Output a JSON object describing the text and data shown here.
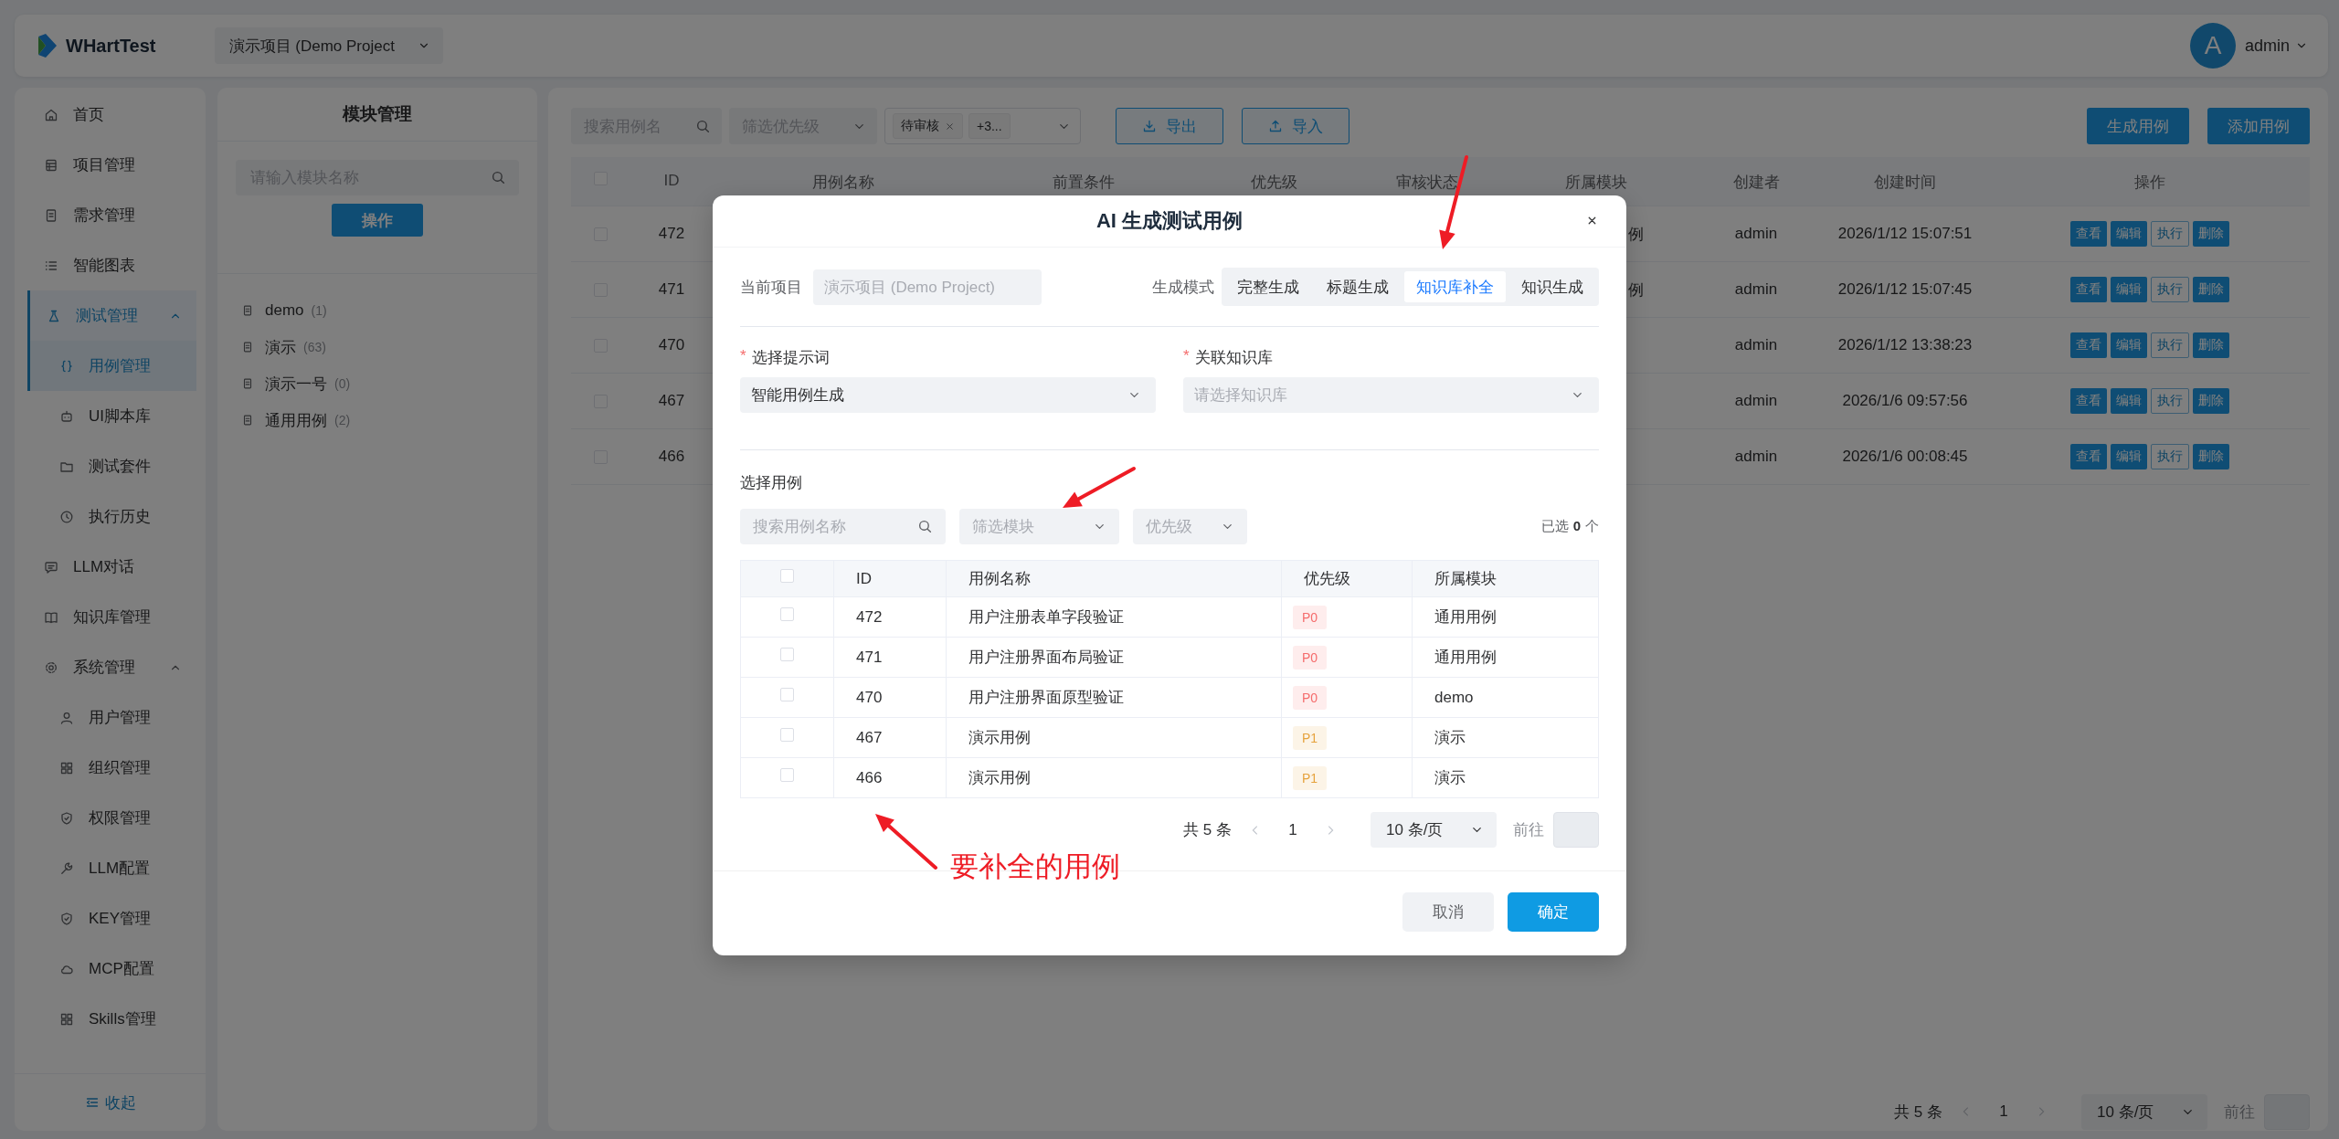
{
  "header": {
    "app_name": "WHartTest",
    "project": "演示项目 (Demo Project",
    "user": {
      "avatar": "A",
      "name": "admin"
    }
  },
  "sidebar": {
    "items": [
      {
        "label": "首页",
        "selected": false
      },
      {
        "label": "项目管理",
        "selected": false
      },
      {
        "label": "需求管理",
        "selected": false
      },
      {
        "label": "智能图表",
        "selected": false
      },
      {
        "label": "测试管理",
        "selected": false,
        "expanded": true,
        "children": [
          {
            "label": "用例管理",
            "selected": true
          },
          {
            "label": "UI脚本库",
            "selected": false
          },
          {
            "label": "测试套件",
            "selected": false
          },
          {
            "label": "执行历史",
            "selected": false
          }
        ]
      },
      {
        "label": "LLM对话",
        "selected": false
      },
      {
        "label": "知识库管理",
        "selected": false
      },
      {
        "label": "系统管理",
        "selected": false,
        "expanded": true,
        "children": [
          {
            "label": "用户管理",
            "selected": false
          },
          {
            "label": "组织管理",
            "selected": false
          },
          {
            "label": "权限管理",
            "selected": false
          },
          {
            "label": "LLM配置",
            "selected": false
          },
          {
            "label": "KEY管理",
            "selected": false
          },
          {
            "label": "MCP配置",
            "selected": false
          },
          {
            "label": "Skills管理",
            "selected": false
          }
        ]
      }
    ],
    "collapse": "收起"
  },
  "module_panel": {
    "title": "模块管理",
    "search": {
      "placeholder": "请输入模块名称"
    },
    "action": "操作",
    "tree": [
      {
        "label": "demo",
        "count": "(1)"
      },
      {
        "label": "演示",
        "count": "(63)"
      },
      {
        "label": "演示一号",
        "count": "(0)"
      },
      {
        "label": "通用用例",
        "count": "(2)"
      }
    ]
  },
  "main": {
    "toolbar": {
      "search": {
        "placeholder": "搜索用例名"
      },
      "priority_filter": {
        "placeholder": "筛选优先级"
      },
      "status_filter": {
        "tags": [
          "待审核"
        ],
        "more": "+3..."
      },
      "buttons": [
        {
          "label": "导出",
          "kind": "export"
        },
        {
          "label": "导入",
          "kind": "import"
        }
      ],
      "actions": [
        "生成用例",
        "添加用例"
      ]
    },
    "table": {
      "checked": false,
      "columns": [
        "ID",
        "用例名称",
        "前置条件",
        "优先级",
        "审核状态",
        "所属模块",
        "创建者",
        "创建时间",
        "操作"
      ],
      "rows": [
        {
          "checked": false,
          "id": "472",
          "module": "例",
          "creator": "admin",
          "created": "2026/1/12 15:07:51",
          "actions": [
            {
              "label": "查看",
              "kind": "primary"
            },
            {
              "label": "编辑",
              "kind": "primary"
            },
            {
              "label": "执行",
              "kind": "outline"
            },
            {
              "label": "删除",
              "kind": "primary"
            }
          ]
        },
        {
          "checked": false,
          "id": "471",
          "module": "例",
          "creator": "admin",
          "created": "2026/1/12 15:07:45",
          "actions": [
            {
              "label": "查看",
              "kind": "primary"
            },
            {
              "label": "编辑",
              "kind": "primary"
            },
            {
              "label": "执行",
              "kind": "outline"
            },
            {
              "label": "删除",
              "kind": "primary"
            }
          ]
        },
        {
          "checked": false,
          "id": "470",
          "creator": "admin",
          "created": "2026/1/12 13:38:23",
          "actions": [
            {
              "label": "查看",
              "kind": "primary"
            },
            {
              "label": "编辑",
              "kind": "primary"
            },
            {
              "label": "执行",
              "kind": "outline"
            },
            {
              "label": "删除",
              "kind": "primary"
            }
          ]
        },
        {
          "checked": false,
          "id": "467",
          "creator": "admin",
          "created": "2026/1/6 09:57:56",
          "actions": [
            {
              "label": "查看",
              "kind": "primary"
            },
            {
              "label": "编辑",
              "kind": "primary"
            },
            {
              "label": "执行",
              "kind": "outline"
            },
            {
              "label": "删除",
              "kind": "primary"
            }
          ]
        },
        {
          "checked": false,
          "id": "466",
          "creator": "admin",
          "created": "2026/1/6 00:08:45",
          "actions": [
            {
              "label": "查看",
              "kind": "primary"
            },
            {
              "label": "编辑",
              "kind": "primary"
            },
            {
              "label": "执行",
              "kind": "outline"
            },
            {
              "label": "删除",
              "kind": "primary"
            }
          ]
        }
      ]
    },
    "pagination": {
      "total": "共 5 条",
      "page": "1",
      "page_size": "10 条/页",
      "goto": "前往"
    }
  },
  "dialog": {
    "title": "AI 生成测试用例",
    "project": {
      "label": "当前项目",
      "value": "演示项目 (Demo Project)",
      "disabled": true
    },
    "mode": {
      "label": "生成模式",
      "options": [
        {
          "label": "完整生成",
          "selected": false
        },
        {
          "label": "标题生成",
          "selected": false
        },
        {
          "label": "知识库补全",
          "selected": true
        },
        {
          "label": "知识生成",
          "selected": false
        }
      ]
    },
    "prompt": {
      "label": "选择提示词",
      "required_mark": "*",
      "value": "智能用例生成"
    },
    "knowledge": {
      "label": "关联知识库",
      "required_mark": "*",
      "placeholder": "请选择知识库"
    },
    "cases": {
      "label": "选择用例",
      "search": {
        "placeholder": "搜索用例名称"
      },
      "module_filter": {
        "placeholder": "筛选模块"
      },
      "priority_filter": {
        "placeholder": "优先级"
      },
      "selected_prefix": "已选",
      "selected_count": "0",
      "selected_suffix": "个",
      "checked": false,
      "columns": [
        "ID",
        "用例名称",
        "优先级",
        "所属模块"
      ],
      "rows": [
        {
          "checked": false,
          "id": "472",
          "name": "用户注册表单字段验证",
          "priority": {
            "label": "P0",
            "color": "#f56c6c"
          },
          "module": "通用用例"
        },
        {
          "checked": false,
          "id": "471",
          "name": "用户注册界面布局验证",
          "priority": {
            "label": "P0",
            "color": "#f56c6c"
          },
          "module": "通用用例"
        },
        {
          "checked": false,
          "id": "470",
          "name": "用户注册界面原型验证",
          "priority": {
            "label": "P0",
            "color": "#f56c6c"
          },
          "module": "demo"
        },
        {
          "checked": false,
          "id": "467",
          "name": "演示用例",
          "priority": {
            "label": "P1",
            "color": "#e6a23c"
          },
          "module": "演示"
        },
        {
          "checked": false,
          "id": "466",
          "name": "演示用例",
          "priority": {
            "label": "P1",
            "color": "#e6a23c"
          },
          "module": "演示"
        }
      ],
      "pagination": {
        "total": "共 5 条",
        "page": "1",
        "page_size": "10 条/页",
        "goto": "前往"
      }
    },
    "buttons": [
      {
        "label": "取消",
        "kind": "secondary"
      },
      {
        "label": "确定",
        "kind": "primary"
      }
    ]
  },
  "annotation": {
    "text": "要补全的用例"
  }
}
